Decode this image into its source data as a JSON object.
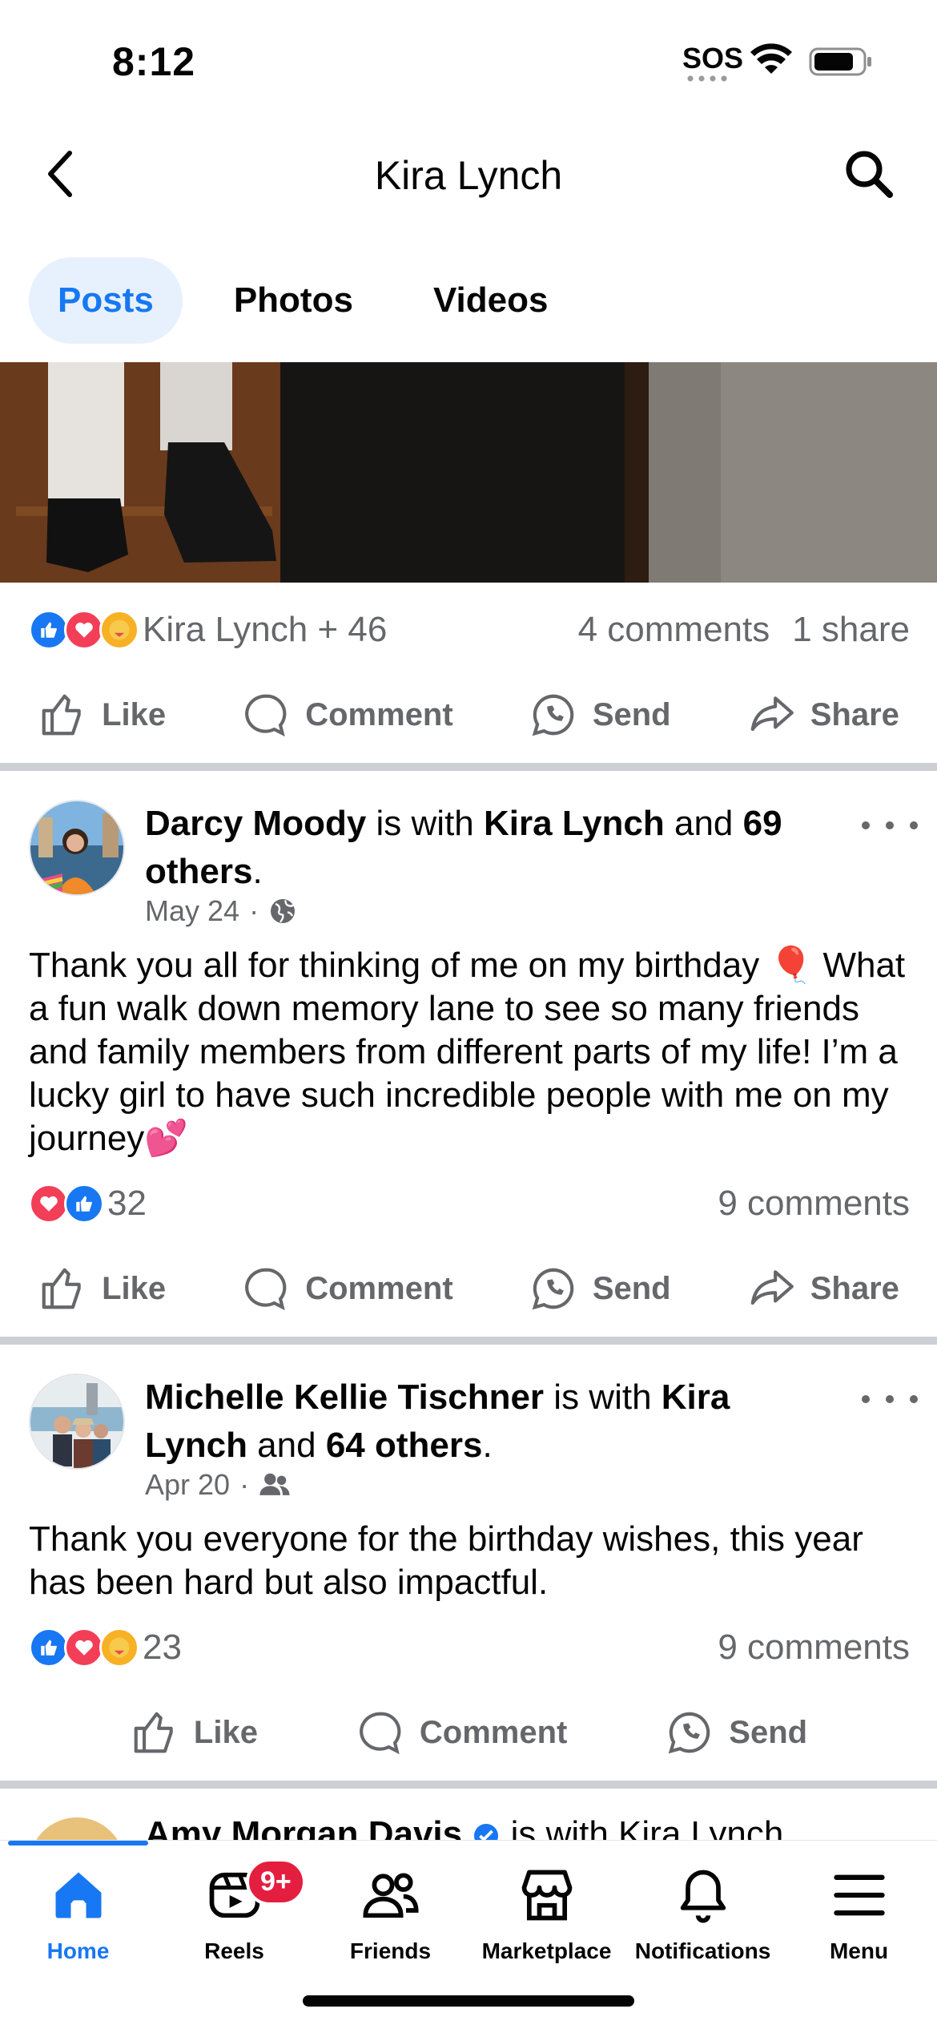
{
  "status_bar": {
    "time": "8:12",
    "sos": "SOS"
  },
  "header": {
    "title": "Kira Lynch"
  },
  "tabs": [
    {
      "label": "Posts",
      "active": true
    },
    {
      "label": "Photos",
      "active": false
    },
    {
      "label": "Videos",
      "active": false
    }
  ],
  "post0": {
    "reactions_text": "Kira Lynch + 46",
    "comments": "4 comments",
    "shares": "1 share"
  },
  "actions": {
    "like": "Like",
    "comment": "Comment",
    "send": "Send",
    "share": "Share"
  },
  "post1": {
    "author": "Darcy Moody",
    "with_text": " is with ",
    "tagged": "Kira Lynch",
    "and_text": " and ",
    "others": "69 others",
    "period": ".",
    "date": "May 24",
    "audience_icon": "globe-icon",
    "text": "Thank you all for thinking of me on my birthday 🎈 What a fun walk down memory lane to see so many friends and family members from different parts of my life! I’m a lucky girl to have such incredible people with me on my journey💕",
    "reaction_count": "32",
    "comments": "9 comments"
  },
  "post2": {
    "author": "Michelle Kellie Tischner",
    "with_text": " is with ",
    "tagged": "Kira Lynch",
    "and_text": " and ",
    "others": "64 others",
    "period": ".",
    "date": "Apr 20",
    "audience_icon": "friends-icon",
    "text": "Thank you everyone for the birthday wishes, this year has been hard but also impactful.",
    "reaction_count": "23",
    "comments": "9 comments"
  },
  "post3_peek": {
    "author": "Amy Morgan Davis",
    "with_text": " is with Kira Lynch"
  },
  "nav": {
    "home": "Home",
    "reels": "Reels",
    "reels_badge": "9+",
    "friends": "Friends",
    "marketplace": "Marketplace",
    "notifications": "Notifications",
    "menu": "Menu"
  },
  "colors": {
    "accent": "#1877f2",
    "like": "#1877f2",
    "love": "#f33e58",
    "care": "#f7b125",
    "badge": "#e41e3f"
  }
}
